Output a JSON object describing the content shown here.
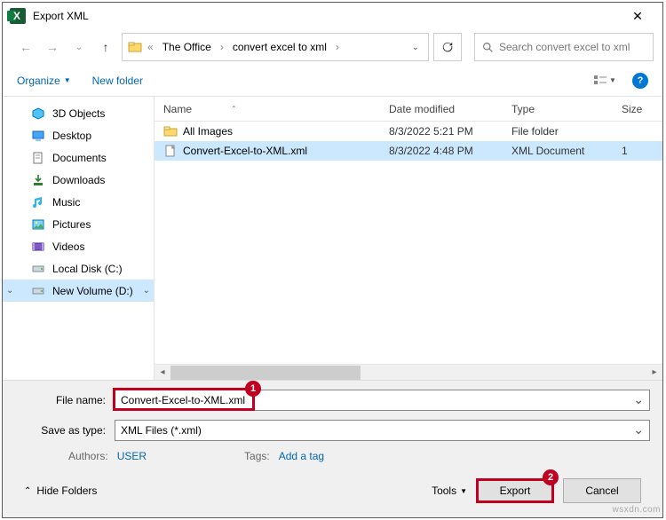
{
  "title": "Export XML",
  "breadcrumb": {
    "folder1": "The Office",
    "folder2": "convert excel to xml"
  },
  "search": {
    "placeholder": "Search convert excel to xml"
  },
  "toolbar": {
    "organize": "Organize",
    "newfolder": "New folder"
  },
  "sidebar": {
    "items": [
      {
        "label": "3D Objects"
      },
      {
        "label": "Desktop"
      },
      {
        "label": "Documents"
      },
      {
        "label": "Downloads"
      },
      {
        "label": "Music"
      },
      {
        "label": "Pictures"
      },
      {
        "label": "Videos"
      },
      {
        "label": "Local Disk (C:)"
      },
      {
        "label": "New Volume (D:)"
      }
    ]
  },
  "columns": {
    "name": "Name",
    "date": "Date modified",
    "type": "Type",
    "size": "Size"
  },
  "files": [
    {
      "name": "All Images",
      "date": "8/3/2022 5:21 PM",
      "type": "File folder",
      "size": ""
    },
    {
      "name": "Convert-Excel-to-XML.xml",
      "date": "8/3/2022 4:48 PM",
      "type": "XML Document",
      "size": "1"
    }
  ],
  "fields": {
    "filename_label": "File name:",
    "filename_value": "Convert-Excel-to-XML.xml",
    "savetype_label": "Save as type:",
    "savetype_value": "XML Files (*.xml)"
  },
  "meta": {
    "authors_label": "Authors:",
    "authors_value": "USER",
    "tags_label": "Tags:",
    "tags_value": "Add a tag"
  },
  "actions": {
    "hide": "Hide Folders",
    "tools": "Tools",
    "export": "Export",
    "cancel": "Cancel"
  },
  "badges": {
    "one": "1",
    "two": "2"
  },
  "watermark": "wsxdn.com"
}
